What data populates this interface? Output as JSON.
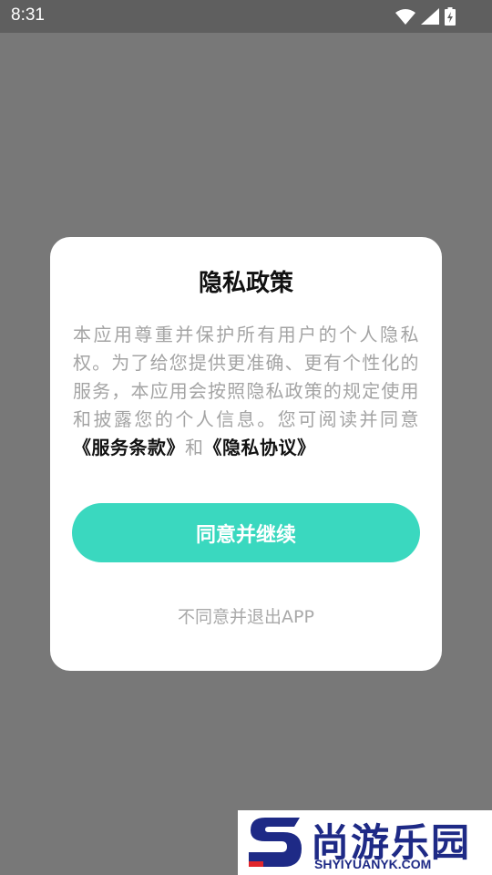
{
  "status_bar": {
    "time": "8:31",
    "icons": [
      "wifi-icon",
      "signal-icon",
      "battery-charging-icon"
    ]
  },
  "dialog": {
    "title": "隐私政策",
    "body_prefix": "本应用尊重并保护所有用户的个人隐私权。为了给您提供更准确、更有个性化的服务，本应用会按照隐私政策的规定使用和披露您的个人信息。您可阅读并同意",
    "terms_link": "《服务条款》",
    "conjunction": "和",
    "privacy_link": "《隐私协议》",
    "agree_label": "同意并继续",
    "disagree_label": "不同意并退出APP"
  },
  "watermark": {
    "name": "尚游乐园",
    "url": "SHYIYUANYK.COM"
  },
  "colors": {
    "accent": "#3ad8bf",
    "overlay": "#787878",
    "status_bar": "#5f5f5f",
    "watermark_blue": "#1e2a86",
    "watermark_red": "#e1262c"
  }
}
